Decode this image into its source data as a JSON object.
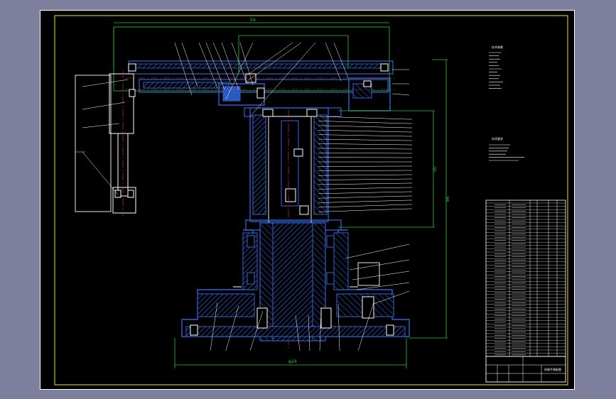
{
  "colors": {
    "viewport_bg": "#7d7f9c",
    "sheet_bg": "#000000",
    "frame": "#ffffff",
    "inner_frame": "#f2e41a",
    "outline": "#2f63d8",
    "hatch": "#2f63d8",
    "dimension": "#22cc33",
    "center_line": "#e23b3b",
    "leader": "#ffffff",
    "text": "#ffffff"
  },
  "icons": {
    "base_fill": "hatched-section",
    "balloon_marks": "small-tick-labels"
  },
  "drawing": {
    "title_block_name": "机械手装配图",
    "overall_width_label": "φ24",
    "height_dim_label": "86",
    "top_dim_label": "54",
    "right_dim_label": "50"
  },
  "notes": {
    "block1_title": "技术参数",
    "block2_title": "技术要求"
  },
  "parts_table": {
    "header_cells": [
      "序号",
      "代号",
      "名称",
      "数量",
      "材料",
      "重量",
      "备注"
    ]
  }
}
